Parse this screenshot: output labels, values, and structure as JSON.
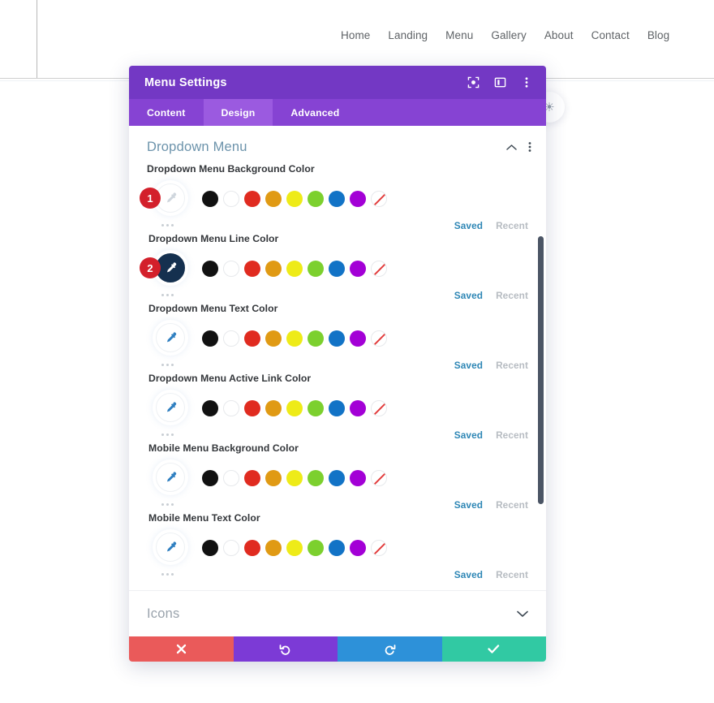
{
  "site": {
    "nav_items": [
      {
        "label": "Home"
      },
      {
        "label": "Landing"
      },
      {
        "label": "Menu"
      },
      {
        "label": "Gallery"
      },
      {
        "label": "About"
      },
      {
        "label": "Contact"
      },
      {
        "label": "Blog"
      }
    ],
    "float_button_icon": "globe-icon"
  },
  "modal": {
    "title": "Menu Settings",
    "header_icons": [
      {
        "name": "target-icon"
      },
      {
        "name": "panel-layout-icon"
      },
      {
        "name": "kebab-menu-icon"
      }
    ],
    "tabs": [
      {
        "label": "Content",
        "active": false
      },
      {
        "label": "Design",
        "active": true
      },
      {
        "label": "Advanced",
        "active": false
      }
    ],
    "section": {
      "title": "Dropdown Menu",
      "collapse_icon": "chevron-up-icon",
      "options_icon": "kebab-menu-icon"
    },
    "saved_label": "Saved",
    "recent_label": "Recent",
    "palette": [
      {
        "name": "black",
        "hex": "#111111"
      },
      {
        "name": "white",
        "hex": "#ffffff"
      },
      {
        "name": "red",
        "hex": "#e02b20"
      },
      {
        "name": "orange",
        "hex": "#e09a14"
      },
      {
        "name": "yellow",
        "hex": "#eeeb18"
      },
      {
        "name": "green",
        "hex": "#7cd02e"
      },
      {
        "name": "blue",
        "hex": "#1273c6"
      },
      {
        "name": "purple",
        "hex": "#a300d6"
      },
      {
        "name": "transparent",
        "hex": "transparent"
      }
    ],
    "fields": [
      {
        "label": "Dropdown Menu Background Color",
        "badge": "1",
        "picker_style": "light"
      },
      {
        "label": "Dropdown Menu Line Color",
        "badge": "2",
        "picker_style": "dark"
      },
      {
        "label": "Dropdown Menu Text Color",
        "badge": "",
        "picker_style": "light"
      },
      {
        "label": "Dropdown Menu Active Link Color",
        "badge": "",
        "picker_style": "light"
      },
      {
        "label": "Mobile Menu Background Color",
        "badge": "",
        "picker_style": "light"
      },
      {
        "label": "Mobile Menu Text Color",
        "badge": "",
        "picker_style": "light"
      }
    ],
    "collapsed_section": {
      "title": "Icons",
      "expand_icon": "chevron-down-icon"
    },
    "footer_buttons": [
      {
        "name": "cancel-button",
        "icon": "x-icon",
        "color": "#ea5a5a"
      },
      {
        "name": "undo-button",
        "icon": "undo-icon",
        "color": "#7c3ad6"
      },
      {
        "name": "redo-button",
        "icon": "redo-icon",
        "color": "#2d91d9"
      },
      {
        "name": "save-button",
        "icon": "check-icon",
        "color": "#31c9a3"
      }
    ]
  },
  "colors": {
    "header_purple": "#7338c4",
    "tabbar_purple": "#8643d3",
    "tab_active_purple": "#9b5ae0",
    "badge_red": "#d3202b",
    "section_title_blue": "#6c93ab",
    "saved_blue": "#2d86b5"
  }
}
